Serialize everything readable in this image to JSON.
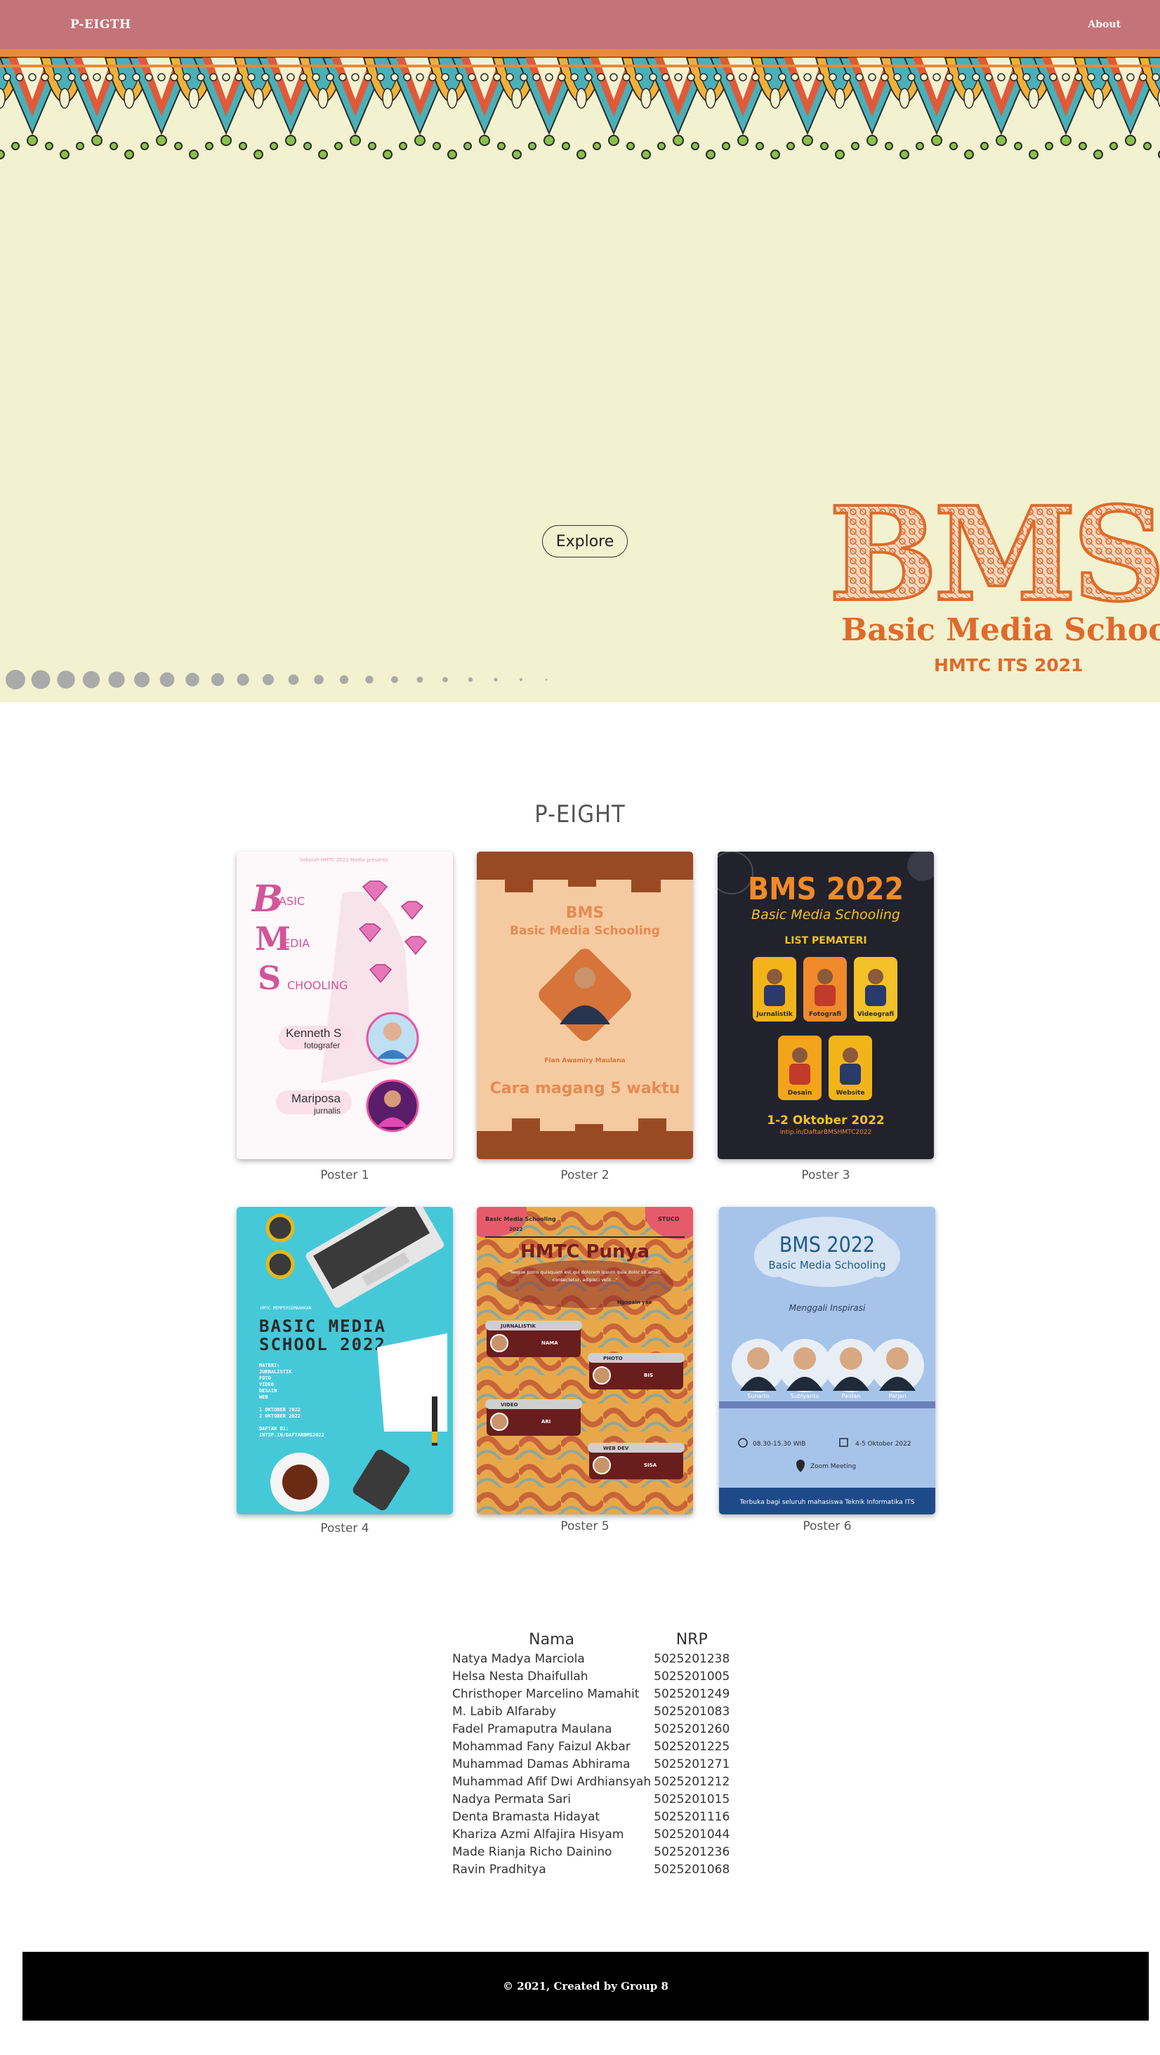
{
  "nav": {
    "brand": "P-EIGTH",
    "about_label": "About"
  },
  "hero": {
    "explore_label": "Explore",
    "logo_big": "BMS",
    "logo_sub": "Basic Media Schooling",
    "logo_org": "HMTC ITS 2021"
  },
  "section": {
    "title": "P-EIGHT"
  },
  "posters": [
    {
      "caption": "Poster 1",
      "header": "Sekolah HMTC 2021 Media presents",
      "letters": [
        "B",
        "M",
        "S"
      ],
      "words": [
        "ASIC",
        "EDIA",
        "CHOOLING"
      ],
      "person1_name": "Kenneth S",
      "person1_role": "fotografer",
      "person2_name": "Mariposa",
      "person2_role": "jurnalis"
    },
    {
      "caption": "Poster 2",
      "title": "BMS",
      "subtitle": "Basic Media Schooling",
      "speaker": "Fian Awamiry Maulana",
      "headline": "Cara magang 5 waktu"
    },
    {
      "caption": "Poster 3",
      "title": "BMS 2022",
      "subtitle": "Basic Media Schooling",
      "list_label": "LIST PEMATERI",
      "speakers": [
        "Jurnalistik",
        "Fotografi",
        "Videografi",
        "Desain",
        "Website"
      ],
      "date": "1-2 Oktober 2022",
      "link": "intip.in/DaftarBMSHMTC2022"
    },
    {
      "caption": "Poster 4",
      "org": "HMTC MEMPERSEMBAHKAN",
      "title_line1": "BASIC MEDIA",
      "title_line2": "SCHOOL 2022",
      "materi": [
        "MATERI:",
        "JURNALISTIK",
        "FOTO",
        "VIDEO",
        "DESAIN",
        "WEB"
      ],
      "dates": [
        "1 OKTOBER 2022",
        "2 OKTOBER 2022"
      ],
      "daftar": [
        "DAFTAR DI:",
        "INTIP.IN/DAFTARBMS2022"
      ]
    },
    {
      "caption": "Poster 5",
      "top_left": "Basic Media Schooling",
      "top_year": "2022",
      "top_right": "STUCO",
      "title": "HMTC Punya",
      "quote": "\"Neque porro quisquam est qui dolorem ipsum quia dolor sit amet, consectetur, adipisci velit...\"",
      "quote_by": "Ngapain yaa",
      "rows": [
        {
          "label": "JURNALISTIK",
          "name": "NAMA"
        },
        {
          "label": "PHOTO",
          "name": "BIS"
        },
        {
          "label": "VIDEO",
          "name": "ARI"
        },
        {
          "label": "WEB DEV",
          "name": "SISA"
        }
      ]
    },
    {
      "caption": "Poster 6",
      "title": "BMS 2022",
      "subtitle": "Basic Media Schooling",
      "tagline": "Menggali Inspirasi",
      "speakers": [
        {
          "name": "Sunarto",
          "role": "Fotografi"
        },
        {
          "name": "Subiyanto",
          "role": "Web Design"
        },
        {
          "name": "Paidan",
          "role": "Videografi"
        },
        {
          "name": "Parjan",
          "role": "Design"
        }
      ],
      "time": "08.30-15.30 WIB",
      "date": "4-5 Oktober 2022",
      "venue": "Zoom Meeting",
      "footer": "Terbuka bagi seluruh mahasiswa Teknik Informatika ITS"
    }
  ],
  "team": {
    "col_name": "Nama",
    "col_nrp": "NRP",
    "members": [
      {
        "name": "Natya Madya Marciola",
        "nrp": "5025201238"
      },
      {
        "name": "Helsa Nesta Dhaifullah",
        "nrp": "5025201005"
      },
      {
        "name": "Christhoper Marcelino Mamahit",
        "nrp": "5025201249"
      },
      {
        "name": "M. Labib Alfaraby",
        "nrp": "5025201083"
      },
      {
        "name": "Fadel Pramaputra Maulana",
        "nrp": "5025201260"
      },
      {
        "name": "Mohammad Fany Faizul Akbar",
        "nrp": "5025201225"
      },
      {
        "name": "Muhammad Damas Abhirama",
        "nrp": "5025201271"
      },
      {
        "name": "Muhammad Afif Dwi Ardhiansyah",
        "nrp": "5025201212"
      },
      {
        "name": "Nadya Permata Sari",
        "nrp": "5025201015"
      },
      {
        "name": "Denta Bramasta Hidayat",
        "nrp": "5025201116"
      },
      {
        "name": "Khariza Azmi Alfajira Hisyam",
        "nrp": "5025201044"
      },
      {
        "name": "Made Rianja Richo Dainino",
        "nrp": "5025201236"
      },
      {
        "name": "Ravin Pradhitya",
        "nrp": "5025201068"
      }
    ]
  },
  "footer": {
    "text": "© 2021, Created by Group 8"
  },
  "colors": {
    "navbar": "#c47478",
    "hero_bg": "#f2f2d0",
    "accent_orange": "#e06a2a",
    "footer_bg": "#000000"
  }
}
